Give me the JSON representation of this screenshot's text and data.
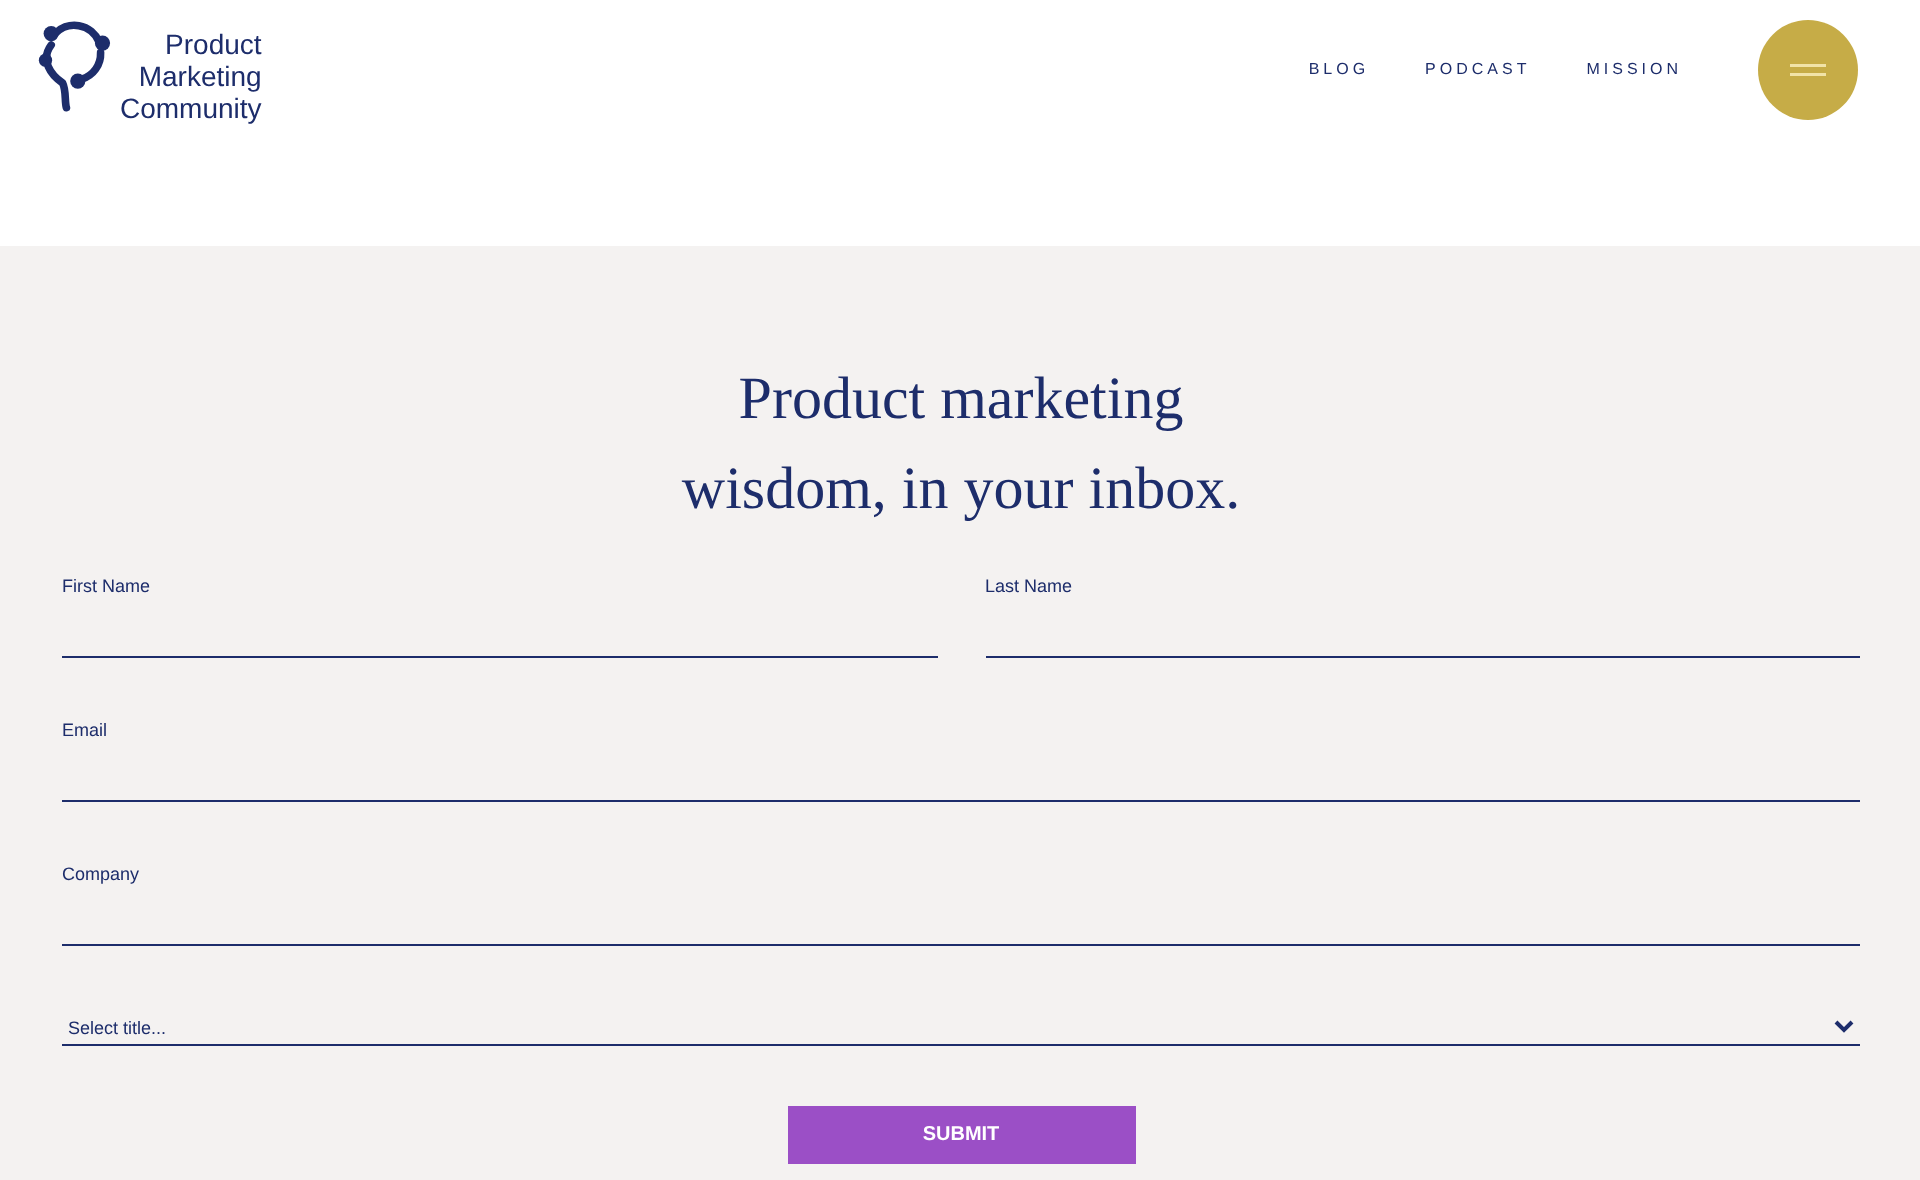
{
  "logo": {
    "lines": [
      "Product",
      "Marketing",
      "Community"
    ]
  },
  "nav": [
    {
      "label": "BLOG"
    },
    {
      "label": "PODCAST"
    },
    {
      "label": "MISSION"
    }
  ],
  "signup": {
    "heading_lines": [
      "Product marketing",
      "wisdom, in your inbox."
    ],
    "field_rows": [
      [
        {
          "label": "First Name"
        },
        {
          "label": "Last Name"
        }
      ],
      [
        {
          "label": "Email"
        }
      ],
      [
        {
          "label": "Company"
        }
      ]
    ],
    "select": {
      "value": "Select title..."
    },
    "submit": "SUBMIT"
  }
}
